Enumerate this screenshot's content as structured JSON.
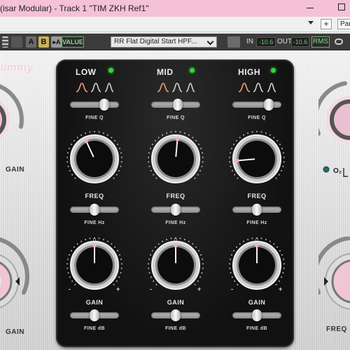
{
  "window": {
    "title": "(isar Modular) - Track 1 \"TIM ZKH Ref1\""
  },
  "host": {
    "plus_label": "+",
    "param_label": "Para"
  },
  "toolbar": {
    "a_label": "A",
    "b_label": "B",
    "copy_label": "▸A",
    "value_label": "VALUE",
    "preset_name": "RR Flat Digital Start HPF...",
    "in_label": "IN",
    "in_value": "-10.6",
    "out_label": "OUT",
    "out_value": "-10.6",
    "rms_label": "RMS",
    "accent_color": "#c9b15a"
  },
  "plugin": {
    "brand_text": "ummy",
    "left_top_label": "GAIN",
    "left_bottom_label": "GAIN",
    "right_o2_label": "O₂",
    "right_bottom_label": "FREQ",
    "bands": [
      {
        "name": "LOW",
        "led_on": true,
        "fine_q": "FINE Q",
        "freq_label": "FREQ",
        "fine_hz": "FINE Hz",
        "gain_label": "GAIN",
        "fine_db": "FINE dB",
        "gain_marker": "0"
      },
      {
        "name": "MID",
        "led_on": true,
        "fine_q": "FINE Q",
        "freq_label": "FREQ",
        "fine_hz": "FINE Hz",
        "gain_label": "GAIN",
        "fine_db": "FINE dB",
        "gain_marker": "0"
      },
      {
        "name": "HIGH",
        "led_on": true,
        "fine_q": "FINE Q",
        "freq_label": "FREQ",
        "fine_hz": "FINE Hz",
        "gain_label": "GAIN",
        "fine_db": "FINE dB",
        "gain_marker": "0"
      }
    ],
    "minus": "-",
    "plus": "+",
    "panel_color": "#141414",
    "led_color": "#36d43a",
    "pink_color": "#f2a9c6"
  }
}
